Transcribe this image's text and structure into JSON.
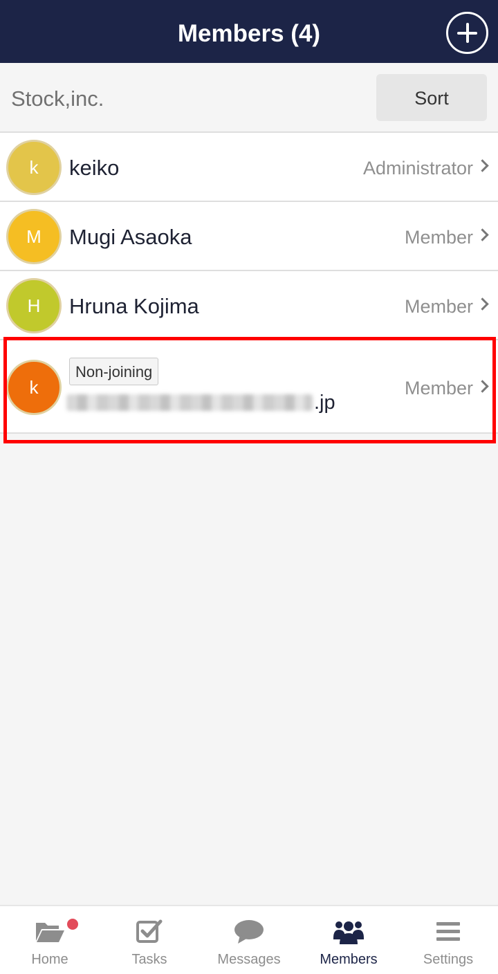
{
  "header": {
    "title": "Members (4)"
  },
  "org": {
    "name": "Stock,inc.",
    "sort_label": "Sort"
  },
  "members": [
    {
      "initial": "k",
      "name": "keiko",
      "role": "Administrator",
      "avatar_color": "#e3c54a"
    },
    {
      "initial": "M",
      "name": "Mugi Asaoka",
      "role": "Member",
      "avatar_color": "#f5be23"
    },
    {
      "initial": "H",
      "name": "Hruna Kojima",
      "role": "Member",
      "avatar_color": "#c1c92c"
    },
    {
      "initial": "k",
      "badge": "Non-joining",
      "email_suffix": ".jp",
      "role": "Member",
      "avatar_color": "#ee6e0b"
    }
  ],
  "tabs": [
    {
      "label": "Home",
      "icon": "folder-icon",
      "notification_dot": true
    },
    {
      "label": "Tasks",
      "icon": "checkbox-icon"
    },
    {
      "label": "Messages",
      "icon": "chat-bubble-icon"
    },
    {
      "label": "Members",
      "icon": "people-icon",
      "active": true
    },
    {
      "label": "Settings",
      "icon": "menu-lines-icon"
    }
  ],
  "colors": {
    "header_bg": "#1c2447",
    "highlight": "#ff0000",
    "notification": "#e24b5a"
  }
}
